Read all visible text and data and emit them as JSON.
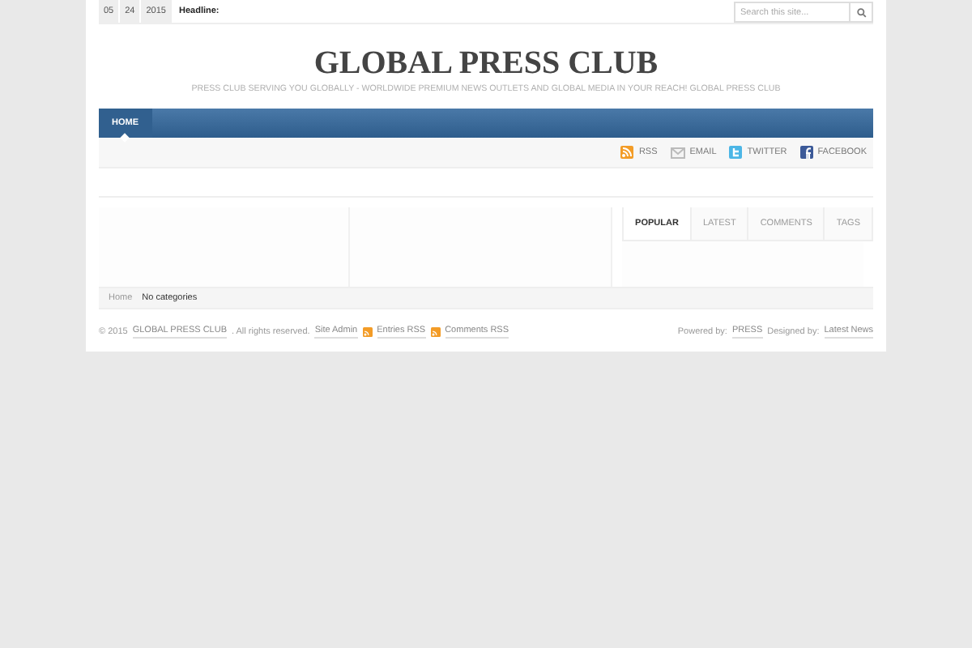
{
  "top_bar": {
    "date": [
      "05",
      "24",
      "2015"
    ],
    "headline_label": "Headline:",
    "search": {
      "placeholder": "Search this site..."
    }
  },
  "header": {
    "title": "GLOBAL PRESS CLUB",
    "tagline": "PRESS CLUB SERVING YOU GLOBALLY - WORLDWIDE PREMIUM NEWS OUTLETS AND GLOBAL MEDIA IN YOUR REACH! GLOBAL PRESS CLUB"
  },
  "nav": [
    {
      "label": "HOME",
      "selected": true
    }
  ],
  "social": [
    {
      "kind": "rss",
      "label": "RSS"
    },
    {
      "kind": "email",
      "label": "EMAIL"
    },
    {
      "kind": "twitter",
      "label": "TWITTER"
    },
    {
      "kind": "facebook",
      "label": "FACEBOOK"
    }
  ],
  "sidebar_tabs": [
    {
      "label": "POPULAR",
      "selected": true
    },
    {
      "label": "LATEST",
      "selected": false
    },
    {
      "label": "COMMENTS",
      "selected": false
    },
    {
      "label": "TAGS",
      "selected": false
    }
  ],
  "breadcrumb": {
    "home": "Home",
    "current": "No categories"
  },
  "footer": {
    "copyright": "© 2015",
    "site_link": "GLOBAL PRESS CLUB",
    "rights": ". All rights reserved.",
    "admin_link": "Site Admin",
    "entries_rss": "Entries RSS",
    "comments_rss": "Comments RSS",
    "powered_label": "Powered by:",
    "powered_link": "PRESS",
    "designed_label": "Designed by:",
    "designed_link": "Latest News"
  }
}
